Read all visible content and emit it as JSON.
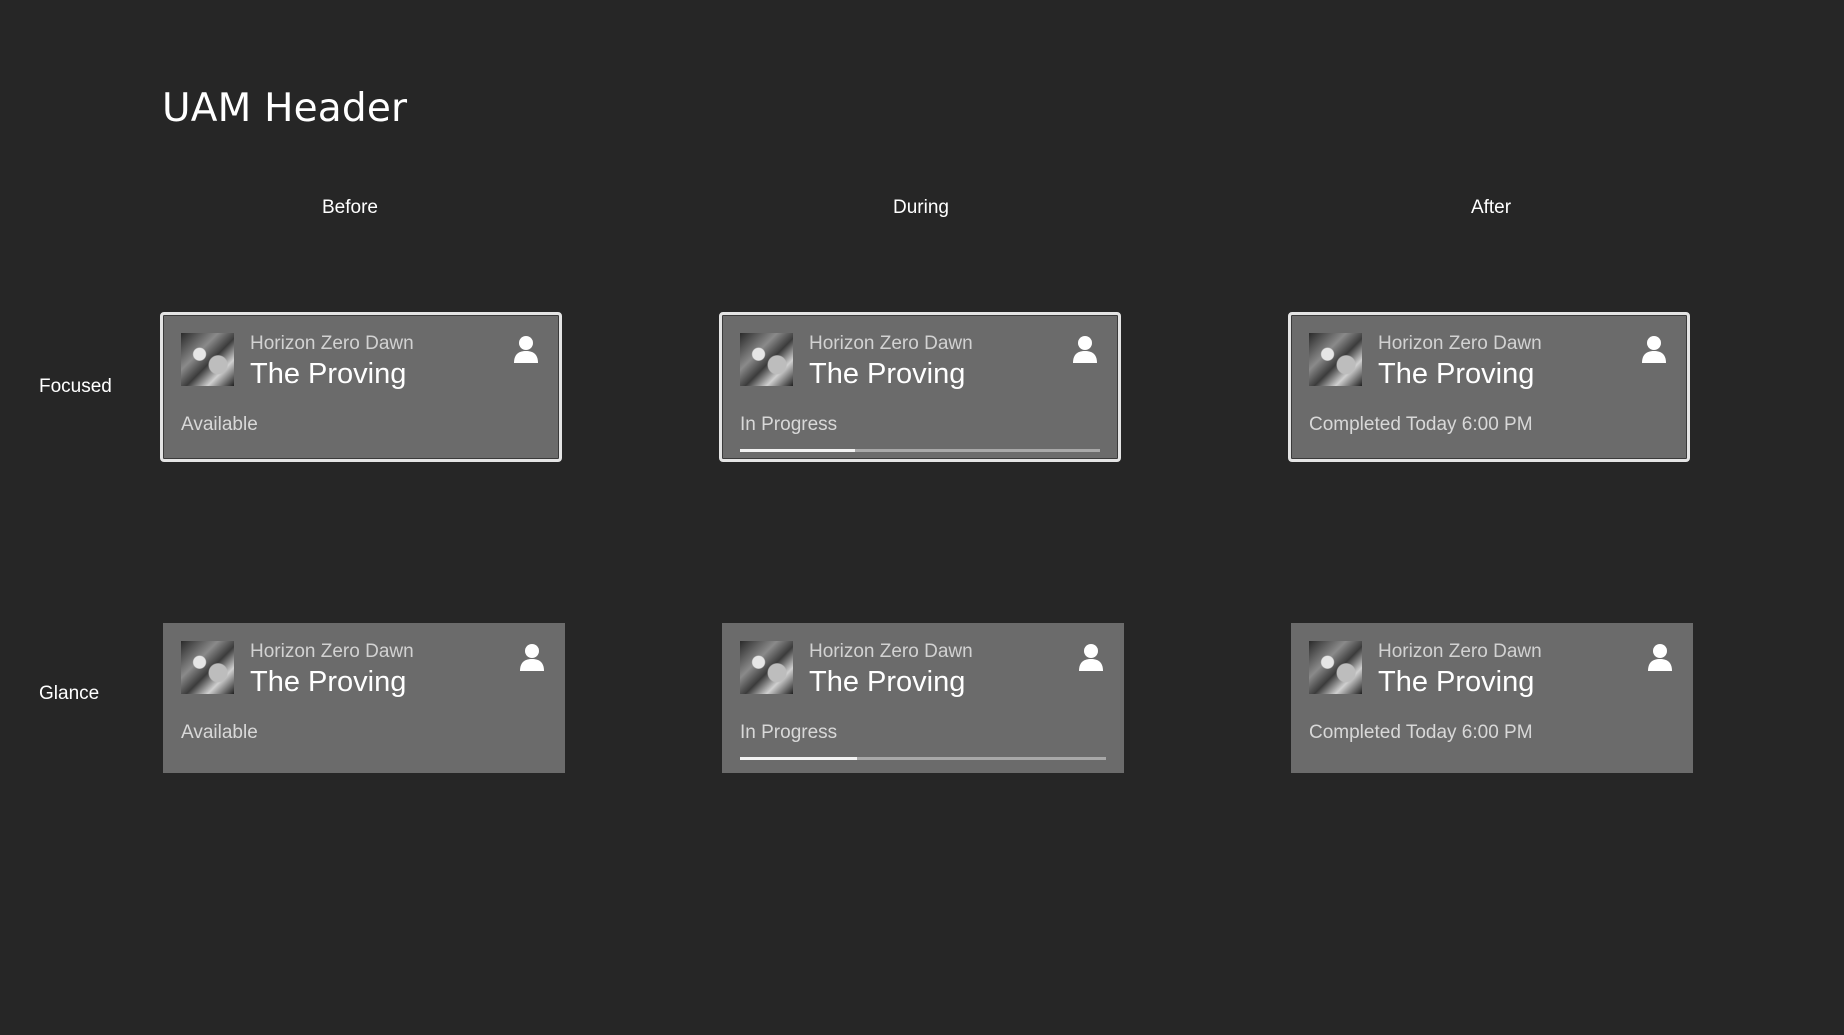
{
  "header": {
    "title": "UAM Header"
  },
  "columns": [
    "Before",
    "During",
    "After"
  ],
  "rows": [
    "Focused",
    "Glance"
  ],
  "card": {
    "game_title": "Horizon Zero Dawn",
    "activity_title": "The Proving",
    "thumbnail_icon": "game-art-thumbnail",
    "user_icon": "person-icon"
  },
  "states": {
    "before": {
      "status": "Available"
    },
    "during": {
      "status": "In Progress",
      "progress": 0.32
    },
    "after": {
      "status": "Completed Today 6:00 PM"
    }
  },
  "colors": {
    "background": "#262626",
    "card": "#6b6b6b",
    "focus_border": "#e4e4e4",
    "progress_fill": "#f2f2f2",
    "progress_track": "#a8a8a8"
  }
}
